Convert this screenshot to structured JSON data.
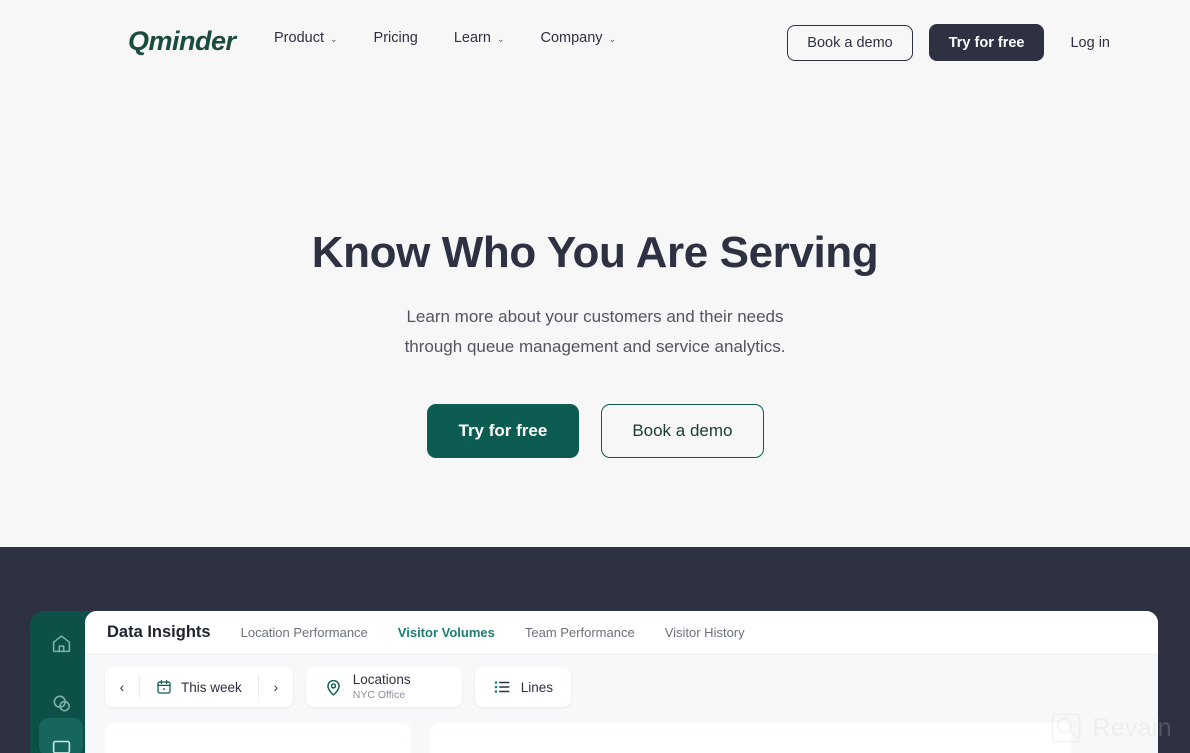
{
  "brand": {
    "logo_text": "Qminder",
    "logo_color": "#1b4a3f"
  },
  "nav": {
    "links": [
      {
        "label": "Product",
        "has_dropdown": true,
        "chevron": "⌄"
      },
      {
        "label": "Pricing",
        "has_dropdown": false,
        "chevron": ""
      },
      {
        "label": "Learn",
        "has_dropdown": true,
        "chevron": "⌄"
      },
      {
        "label": "Company",
        "has_dropdown": true,
        "chevron": "⌄"
      }
    ],
    "book_demo": "Book a demo",
    "try_free": "Try for free",
    "log_in": "Log in"
  },
  "hero": {
    "title": "Know Who You Are Serving",
    "subtitle_line1": "Learn more about your customers and their needs",
    "subtitle_line2": "through queue management and service analytics.",
    "primary_cta": "Try for free",
    "secondary_cta": "Book a demo",
    "primary_color": "#0d5c52"
  },
  "app": {
    "title": "Data Insights",
    "tabs": [
      {
        "label": "Location Performance",
        "active": false
      },
      {
        "label": "Visitor Volumes",
        "active": true
      },
      {
        "label": "Team Performance",
        "active": false
      },
      {
        "label": "Visitor History",
        "active": false
      }
    ],
    "active_tab_color": "#1a7f73",
    "toolbar": {
      "prev": "‹",
      "next": "›",
      "date_range": "This week",
      "locations_label": "Locations",
      "locations_value": "NYC Office",
      "lines_label": "Lines"
    },
    "sidebar": {
      "background": "#0d5048",
      "items": [
        {
          "icon": "home-icon",
          "active": false
        },
        {
          "icon": "chat-icon",
          "active": false
        },
        {
          "icon": "analytics-icon",
          "active": true
        }
      ]
    }
  },
  "watermark": {
    "text": "Revain",
    "icon": "magnifier-square-icon"
  },
  "colors": {
    "page_bg": "#f7f7f8",
    "dark_section": "#2d3142",
    "teal": "#0d5c52",
    "app_body_bg": "#f7f8f9"
  }
}
